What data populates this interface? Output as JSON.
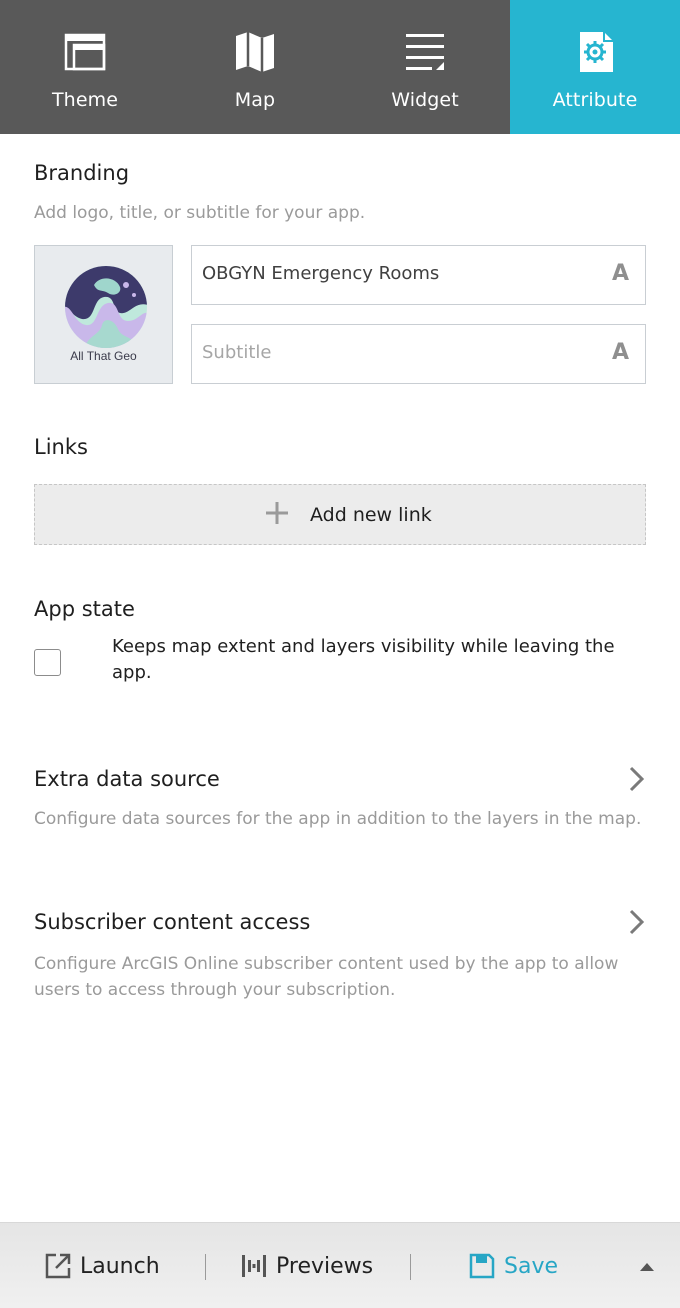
{
  "tabs": [
    {
      "label": "Theme",
      "icon": "theme-icon",
      "active": false
    },
    {
      "label": "Map",
      "icon": "map-icon",
      "active": false
    },
    {
      "label": "Widget",
      "icon": "widget-icon",
      "active": false
    },
    {
      "label": "Attribute",
      "icon": "attribute-icon",
      "active": true
    }
  ],
  "branding": {
    "title": "Branding",
    "description": "Add logo, title, or subtitle for your app.",
    "logo_text": "All That Geo",
    "title_value": "OBGYN Emergency Rooms",
    "subtitle_placeholder": "Subtitle",
    "font_icon_glyph": "A"
  },
  "links": {
    "title": "Links",
    "add_label": "Add new link"
  },
  "app_state": {
    "title": "App state",
    "checkbox_label": "Keeps map extent and layers visibility while leaving the app.",
    "checked": false
  },
  "extra_data_source": {
    "title": "Extra data source",
    "description": "Configure data sources for the app in addition to the layers in the map."
  },
  "subscriber_content": {
    "title": "Subscriber content access",
    "description": "Configure ArcGIS Online subscriber content used by the app to allow users to access through your subscription."
  },
  "footer": {
    "launch_label": "Launch",
    "previews_label": "Previews",
    "save_label": "Save"
  },
  "colors": {
    "tab_bar": "#595959",
    "accent": "#26b5d0",
    "save": "#27a6c5"
  }
}
